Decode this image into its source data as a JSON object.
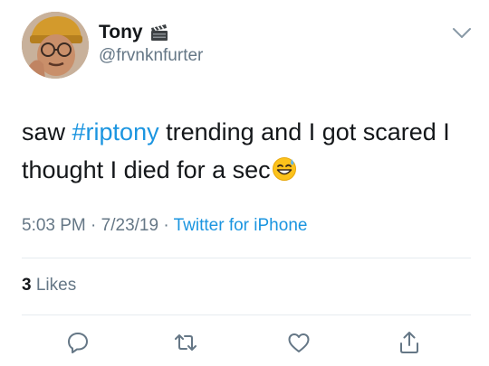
{
  "user": {
    "display_name": "Tony",
    "name_emoji_icon": "clapper-board-icon",
    "handle": "@frvnknfurter"
  },
  "tweet": {
    "text_before": "saw ",
    "hashtag": "#riptony",
    "text_after": " trending and I got scared I thought I died for a sec",
    "trailing_emoji_icon": "grinning-sweat-emoji"
  },
  "meta": {
    "time": "5:03 PM",
    "sep1": " · ",
    "date": "7/23/19",
    "sep2": " · ",
    "source": "Twitter for iPhone"
  },
  "stats": {
    "likes_count": "3",
    "likes_label": "Likes"
  },
  "actions": [
    "reply-icon",
    "retweet-icon",
    "like-icon",
    "share-icon"
  ],
  "colors": {
    "link": "#1b95e0",
    "secondary_text": "#657786",
    "divider": "#e6ecf0"
  }
}
